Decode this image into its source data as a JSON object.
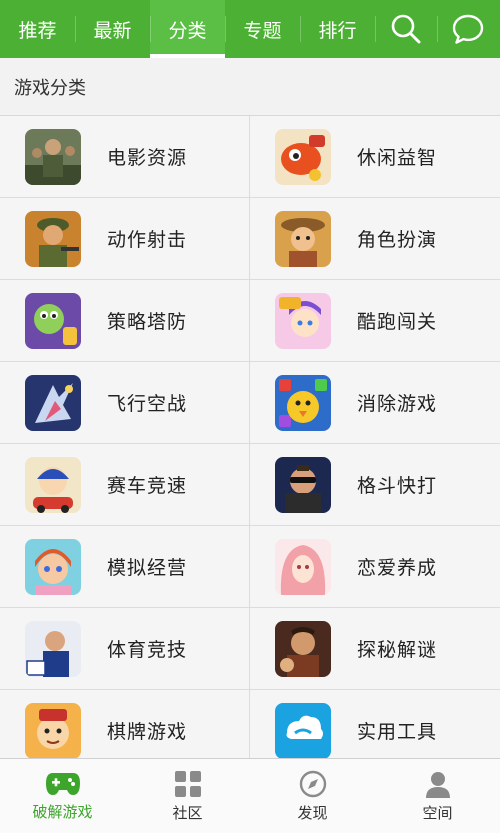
{
  "tabs": [
    {
      "label": "推荐"
    },
    {
      "label": "最新"
    },
    {
      "label": "分类"
    },
    {
      "label": "专题"
    },
    {
      "label": "排行"
    }
  ],
  "active_tab": "分类",
  "top_icons": [
    "search-icon",
    "chat-bubble-icon"
  ],
  "section_title": "游戏分类",
  "categories": [
    {
      "label": "电影资源",
      "icon": "movie-thumbnail"
    },
    {
      "label": "休闲益智",
      "icon": "casual-puzzle-thumbnail"
    },
    {
      "label": "动作射击",
      "icon": "action-shooter-thumbnail"
    },
    {
      "label": "角色扮演",
      "icon": "role-playing-thumbnail"
    },
    {
      "label": "策略塔防",
      "icon": "strategy-tower-defense-thumbnail"
    },
    {
      "label": "酷跑闯关",
      "icon": "runner-thumbnail"
    },
    {
      "label": "飞行空战",
      "icon": "flight-combat-thumbnail"
    },
    {
      "label": "消除游戏",
      "icon": "match-elimination-thumbnail"
    },
    {
      "label": "赛车竞速",
      "icon": "racing-thumbnail"
    },
    {
      "label": "格斗快打",
      "icon": "fighting-thumbnail"
    },
    {
      "label": "模拟经营",
      "icon": "simulation-thumbnail"
    },
    {
      "label": "恋爱养成",
      "icon": "romance-thumbnail"
    },
    {
      "label": "体育竞技",
      "icon": "sports-thumbnail"
    },
    {
      "label": "探秘解谜",
      "icon": "mystery-puzzle-thumbnail"
    },
    {
      "label": "棋牌游戏",
      "icon": "board-card-thumbnail"
    },
    {
      "label": "实用工具",
      "icon": "utility-tools-thumbnail"
    }
  ],
  "bottom_nav": [
    {
      "label": "破解游戏",
      "icon": "gamepad-icon",
      "active": true
    },
    {
      "label": "社区",
      "icon": "grid-icon",
      "active": false
    },
    {
      "label": "发现",
      "icon": "compass-icon",
      "active": false
    },
    {
      "label": "空间",
      "icon": "person-icon",
      "active": false
    }
  ],
  "colors": {
    "brand_green": "#4cb034",
    "active_tab_bg": "#5cbf45",
    "active_nav_text": "#3ea52c",
    "background": "#f2f2f2"
  }
}
